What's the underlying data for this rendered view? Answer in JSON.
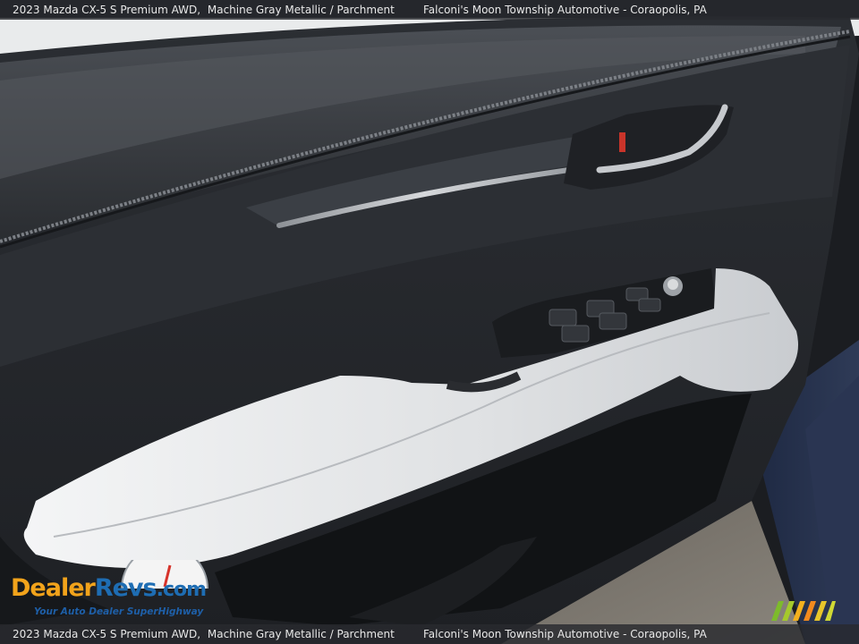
{
  "caption": {
    "vehicle": "2023 Mazda CX-5 S Premium AWD,",
    "color": "Machine Gray Metallic / Parchment",
    "dealer": "Falconi's Moon Township Automotive - Coraopolis, PA"
  },
  "watermark": {
    "brand_part1": "Dealer",
    "brand_part2": "Revs",
    "brand_part3": ".com",
    "tagline": "Your Auto Dealer SuperHighway"
  },
  "colors": {
    "door_dark": "#26292e",
    "armrest": "#e4e6e7",
    "trim": "#b9bcc0",
    "brand_orange": "#f2a31b",
    "brand_blue": "#1e6db3"
  }
}
